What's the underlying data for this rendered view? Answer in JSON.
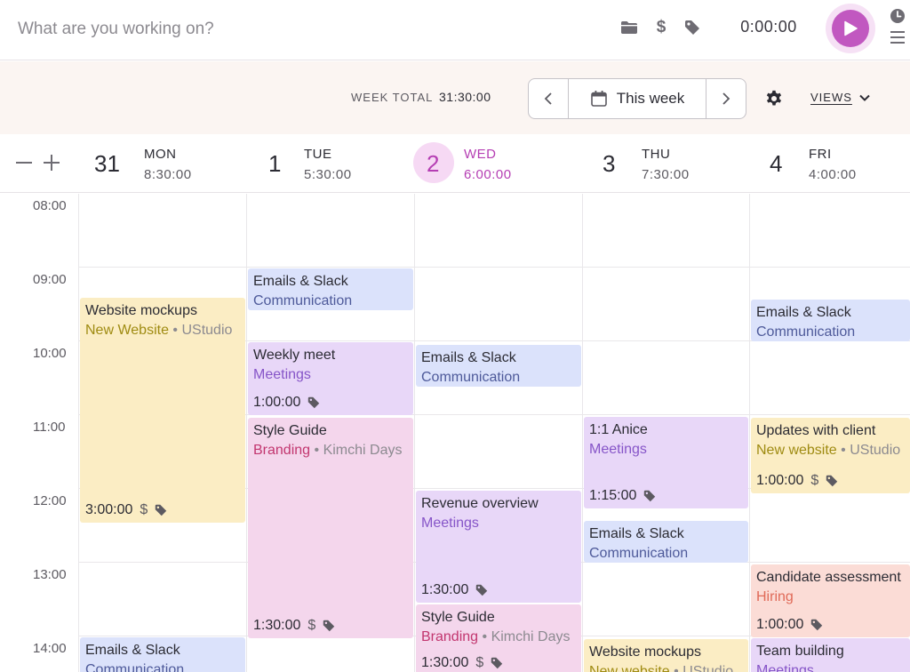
{
  "timer_bar": {
    "description_placeholder": "What are you working on?",
    "time": "0:00:00"
  },
  "header": {
    "week_total_label": "WEEK TOTAL",
    "week_total_value": "31:30:00",
    "range_label": "This week",
    "views_label": "VIEWS"
  },
  "days": [
    {
      "num": "31",
      "name": "MON",
      "total": "8:30:00"
    },
    {
      "num": "1",
      "name": "TUE",
      "total": "5:30:00"
    },
    {
      "num": "2",
      "name": "WED",
      "total": "6:00:00",
      "today": true
    },
    {
      "num": "3",
      "name": "THU",
      "total": "7:30:00"
    },
    {
      "num": "4",
      "name": "FRI",
      "total": "4:00:00"
    }
  ],
  "hours": [
    "08:00",
    "09:00",
    "10:00",
    "11:00",
    "12:00",
    "13:00",
    "14:00"
  ],
  "events": {
    "mon_website_mockups": {
      "title": "Website mockups",
      "project": "New Website",
      "client": "UStudio",
      "duration": "3:00:00"
    },
    "mon_emails": {
      "title": "Emails & Slack",
      "project": "Communication"
    },
    "tue_emails": {
      "title": "Emails & Slack",
      "project": "Communication"
    },
    "tue_weekly_meet": {
      "title": "Weekly meet",
      "project": "Meetings",
      "duration": "1:00:00"
    },
    "tue_style_guide": {
      "title": "Style Guide",
      "project": "Branding",
      "client": "Kimchi Days",
      "duration": "1:30:00"
    },
    "wed_emails": {
      "title": "Emails & Slack",
      "project": "Communication"
    },
    "wed_revenue": {
      "title": "Revenue overview",
      "project": "Meetings",
      "duration": "1:30:00"
    },
    "wed_style_guide": {
      "title": "Style Guide",
      "project": "Branding",
      "client": "Kimchi Days",
      "duration": "1:30:00"
    },
    "thu_anice": {
      "title": "1:1 Anice",
      "project": "Meetings",
      "duration": "1:15:00"
    },
    "thu_emails": {
      "title": "Emails & Slack",
      "project": "Communication"
    },
    "thu_website_mockups": {
      "title": "Website mockups",
      "project": "New website",
      "client": "UStudio"
    },
    "fri_emails": {
      "title": "Emails & Slack",
      "project": "Communication"
    },
    "fri_updates": {
      "title": "Updates with client",
      "project": "New website",
      "client": "UStudio",
      "duration": "1:00:00"
    },
    "fri_candidate": {
      "title": "Candidate assessment",
      "project": "Hiring",
      "duration": "1:00:00"
    },
    "fri_team_building": {
      "title": "Team building",
      "project": "Meetings"
    }
  },
  "colors": {
    "accent": "#c158c0",
    "today": "#b53eb3",
    "communication": "#dbe2fb",
    "new_website": "#fbedc4",
    "meetings": "#e8d7f8",
    "branding": "#f4d6ec",
    "hiring": "#fbdcd6"
  }
}
